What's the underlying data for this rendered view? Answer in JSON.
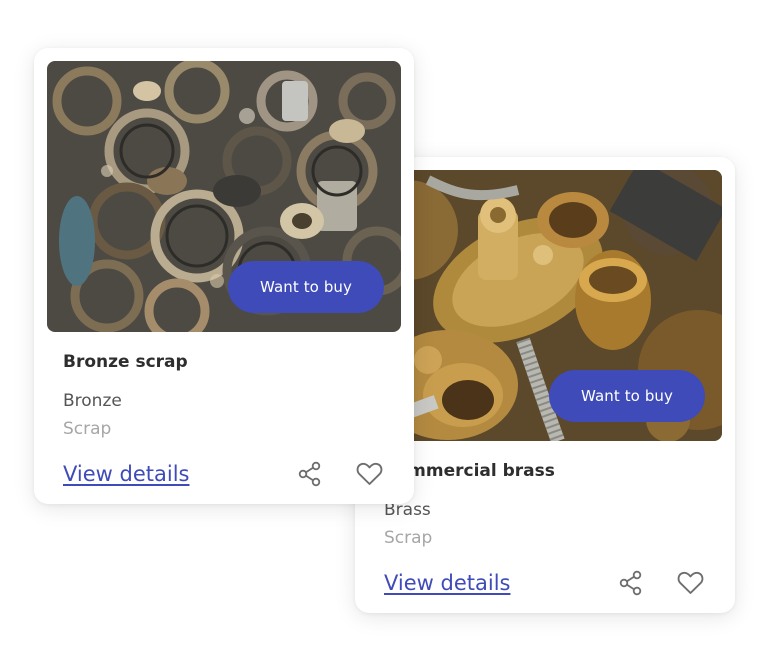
{
  "colors": {
    "accent": "#3f4bb8",
    "title": "#2e2e2e",
    "material": "#555555",
    "category": "#a6a6a6"
  },
  "cards": [
    {
      "title": "Bronze scrap",
      "material": "Bronze",
      "category": "Scrap",
      "buy_label": "Want to buy",
      "details_label": "View details",
      "image_icon": "bronze-scrap-photo",
      "share_icon": "share-icon",
      "favorite_icon": "heart-icon"
    },
    {
      "title": "Commercial brass",
      "material": "Brass",
      "category": "Scrap",
      "buy_label": "Want to buy",
      "details_label": "View details",
      "image_icon": "brass-scrap-photo",
      "share_icon": "share-icon",
      "favorite_icon": "heart-icon"
    }
  ]
}
